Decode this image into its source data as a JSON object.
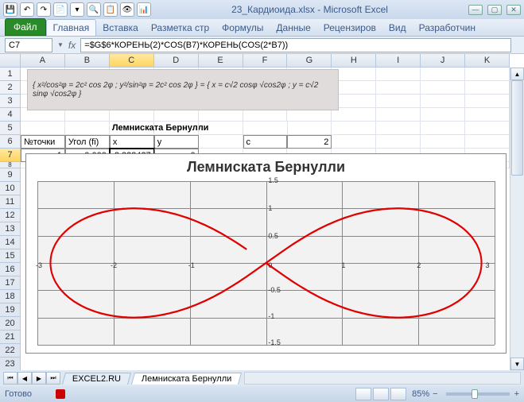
{
  "window": {
    "title": "23_Кардиоида.xlsx - Microsoft Excel"
  },
  "tabs": {
    "file": "Файл",
    "home": "Главная",
    "insert": "Вставка",
    "layout": "Разметка стр",
    "formulas": "Формулы",
    "data": "Данные",
    "review": "Рецензиров",
    "view": "Вид",
    "dev": "Разработчин"
  },
  "namebox": "C7",
  "fx": "fx",
  "formula": "=$G$6*КОРЕНЬ(2)*COS(B7)*КОРЕНЬ(COS(2*B7))",
  "cols": [
    "A",
    "B",
    "C",
    "D",
    "E",
    "F",
    "G",
    "H",
    "I",
    "J",
    "K"
  ],
  "rows": [
    "1",
    "2",
    "3",
    "4",
    "5",
    "6",
    "7",
    "8",
    "9",
    "10",
    "11",
    "12",
    "13",
    "14",
    "15",
    "16",
    "17",
    "18",
    "19",
    "20",
    "21",
    "22",
    "23"
  ],
  "grid": {
    "r5_c": "Лемниската Бернулли",
    "r6_a": "№точки",
    "r6_b": "Угол (fi)",
    "r6_c": "x",
    "r6_d": "y",
    "r6_f": "c",
    "r6_g": "2",
    "r7_a": "1",
    "r7_b": "0,000",
    "r7_c": "2,828427",
    "r7_d": "0"
  },
  "formula_img": "{ x²/cos²φ = 2c² cos 2φ ; y²/sin²φ = 2c² cos 2φ } = { x = c√2 cosφ √cos2φ ; y = c√2 sinφ √cos2φ }",
  "chart": {
    "title": "Лемниската Бернулли",
    "xlim": [
      -3,
      3
    ],
    "ylim": [
      -1.5,
      1.5
    ],
    "xticks": [
      -3,
      -2,
      -1,
      0,
      1,
      2,
      3
    ],
    "yticks": [
      -1.5,
      -1,
      -0.5,
      0,
      0.5,
      1,
      1.5
    ]
  },
  "chart_data": {
    "type": "line",
    "title": "Лемниската Бернулли",
    "xlabel": "",
    "ylabel": "",
    "xlim": [
      -3,
      3
    ],
    "ylim": [
      -1.5,
      1.5
    ],
    "parametric": true,
    "c": 2,
    "equations": {
      "x": "c*sqrt(2)*cos(t)*sqrt(cos(2t))",
      "y": "c*sqrt(2)*sin(t)*sqrt(cos(2t))"
    }
  },
  "sheets": {
    "s1": "EXCEL2.RU",
    "s2": "Лемниската Бернулли"
  },
  "status": {
    "ready": "Готово",
    "zoom": "85%"
  }
}
